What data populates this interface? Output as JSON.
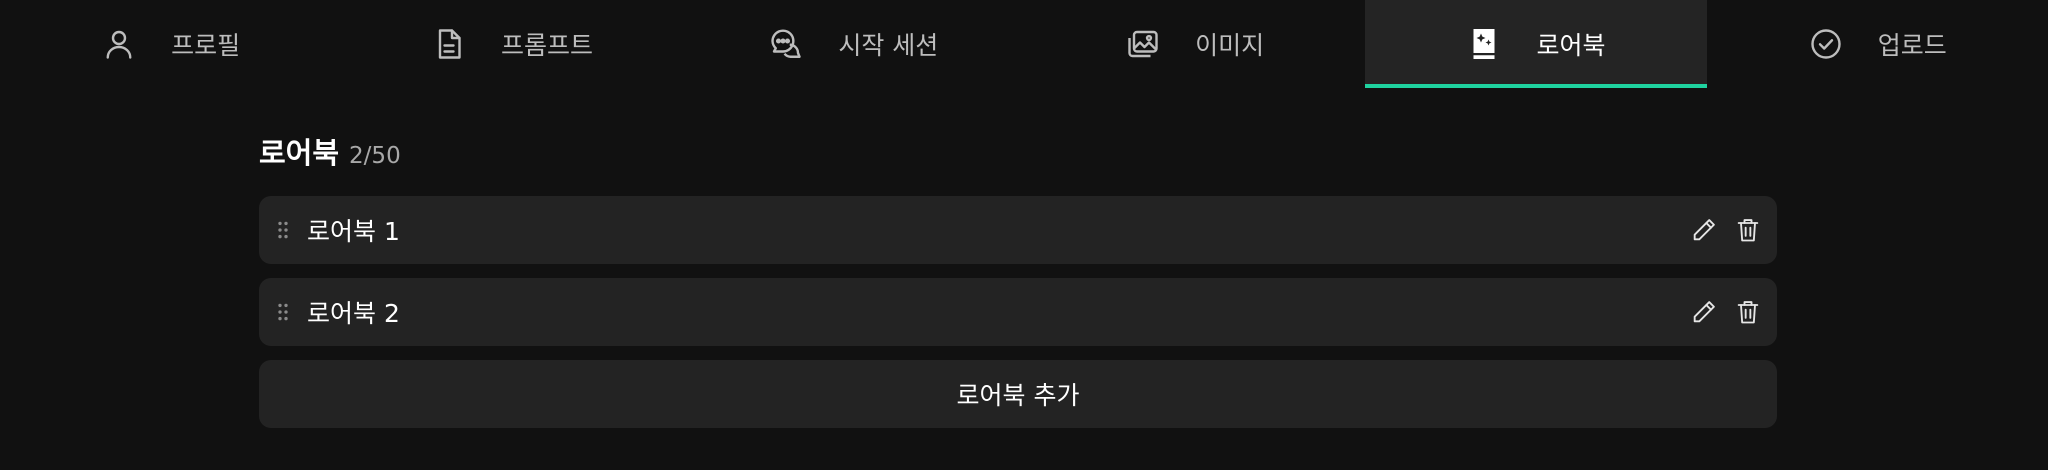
{
  "tabs": [
    {
      "label": "프로필",
      "icon": "user-icon",
      "active": false
    },
    {
      "label": "프롬프트",
      "icon": "document-icon",
      "active": false
    },
    {
      "label": "시작 세션",
      "icon": "chat-bubbles-icon",
      "active": false
    },
    {
      "label": "이미지",
      "icon": "images-icon",
      "active": false
    },
    {
      "label": "로어북",
      "icon": "book-sparkle-icon",
      "active": true
    },
    {
      "label": "업로드",
      "icon": "check-circle-icon",
      "active": false
    }
  ],
  "accent_color": "#1fd3a0",
  "lorebook": {
    "title": "로어북",
    "count": "2/50",
    "items": [
      {
        "name": "로어북 1"
      },
      {
        "name": "로어북 2"
      }
    ],
    "add_label": "로어북 추가"
  }
}
